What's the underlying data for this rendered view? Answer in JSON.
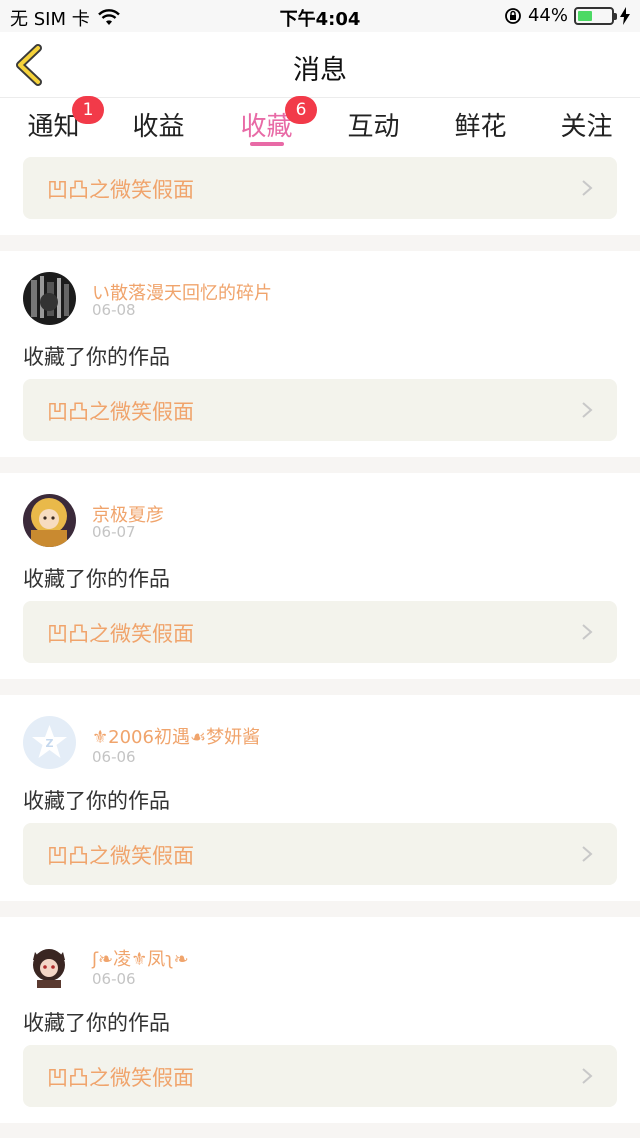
{
  "status_bar": {
    "carrier": "无 SIM 卡",
    "time": "下午4:04",
    "battery_percent": "44%",
    "battery_level": 0.44
  },
  "nav": {
    "title": "消息"
  },
  "tabs": [
    {
      "label": "通知",
      "badge": "1"
    },
    {
      "label": "收益",
      "badge": ""
    },
    {
      "label": "收藏",
      "badge": "6"
    },
    {
      "label": "互动",
      "badge": ""
    },
    {
      "label": "鲜花",
      "badge": ""
    },
    {
      "label": "关注",
      "badge": ""
    }
  ],
  "colors": {
    "accent": "#e86aa6",
    "badge": "#f23a49",
    "name": "#f0a46c",
    "card_bg": "#f3f3ec"
  },
  "feed": {
    "top_work": "凹凸之微笑假面",
    "items": [
      {
        "user": "い散落漫天回忆的碎片",
        "date": "06-08",
        "action": "收藏了你的作品",
        "work": "凹凸之微笑假面",
        "avatar": "dark-avatar"
      },
      {
        "user": "京极夏彦",
        "date": "06-07",
        "action": "收藏了你的作品",
        "work": "凹凸之微笑假面",
        "avatar": "anime-avatar"
      },
      {
        "user": "⚜2006初遇☙梦妍酱",
        "date": "06-06",
        "action": "收藏了你的作品",
        "work": "凹凸之微笑假面",
        "avatar": "qq-default-avatar"
      },
      {
        "user": "ʃ❧凌⚜凤ʅ❧",
        "date": "06-06",
        "action": "收藏了你的作品",
        "work": "凹凸之微笑假面",
        "avatar": "chibi-avatar"
      }
    ]
  }
}
